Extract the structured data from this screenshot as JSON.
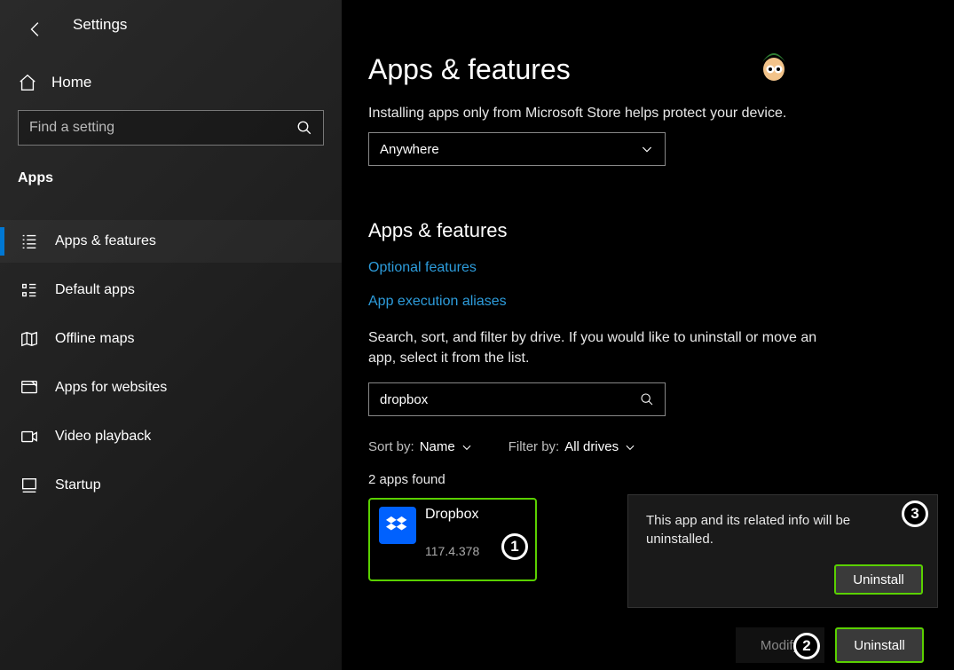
{
  "header": {
    "settings_title": "Settings",
    "home_label": "Home",
    "search_placeholder": "Find a setting",
    "section_label": "Apps"
  },
  "nav": {
    "items": [
      {
        "label": "Apps & features",
        "icon": "list-icon",
        "selected": true
      },
      {
        "label": "Default apps",
        "icon": "defaults-icon"
      },
      {
        "label": "Offline maps",
        "icon": "map-icon"
      },
      {
        "label": "Apps for websites",
        "icon": "website-icon"
      },
      {
        "label": "Video playback",
        "icon": "video-icon"
      },
      {
        "label": "Startup",
        "icon": "startup-icon"
      }
    ]
  },
  "main": {
    "title": "Apps & features",
    "install_note": "Installing apps only from Microsoft Store helps protect your device.",
    "install_source": {
      "selected": "Anywhere"
    },
    "section_heading": "Apps & features",
    "links": {
      "optional_features": "Optional features",
      "app_exec_aliases": "App execution aliases"
    },
    "help_text": "Search, sort, and filter by drive. If you would like to uninstall or move an app, select it from the list.",
    "app_search_value": "dropbox",
    "sort": {
      "label": "Sort by:",
      "value": "Name"
    },
    "filter": {
      "label": "Filter by:",
      "value": "All drives"
    },
    "apps_found_text": "2 apps found",
    "app": {
      "name": "Dropbox",
      "version": "117.4.378"
    },
    "buttons": {
      "modify": "Modify",
      "uninstall": "Uninstall"
    },
    "popup": {
      "message": "This app and its related info will be uninstalled.",
      "confirm": "Uninstall"
    }
  },
  "annotations": {
    "b1": "1",
    "b2": "2",
    "b3": "3"
  }
}
